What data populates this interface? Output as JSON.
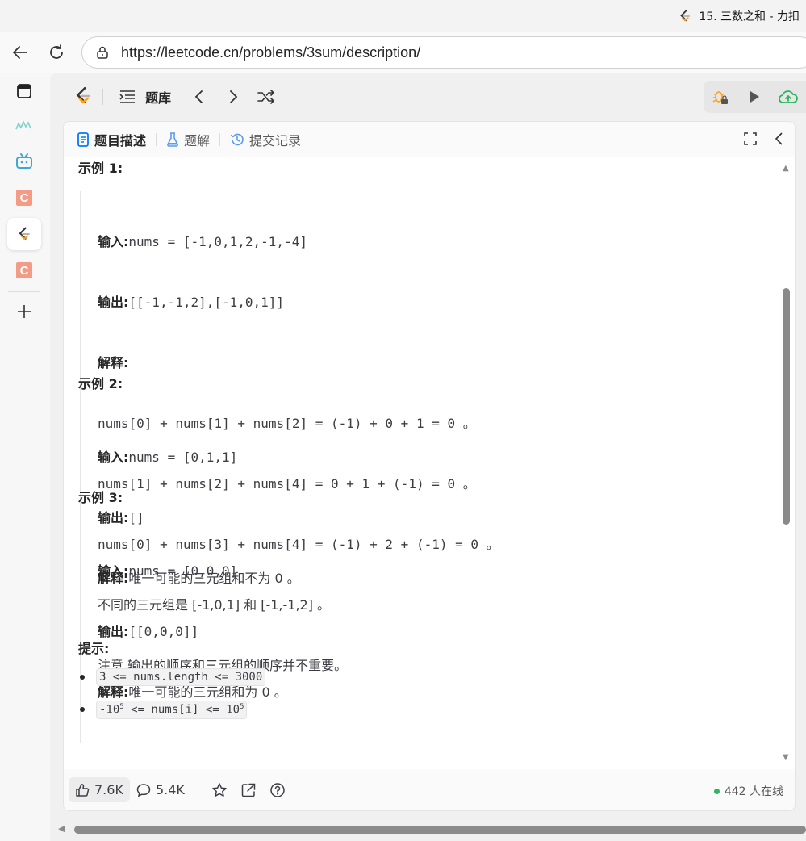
{
  "browser": {
    "tab_title": "15. 三数之和 - 力扣",
    "url": "https://leetcode.cn/problems/3sum/description/"
  },
  "header": {
    "problem_list_label": "题库"
  },
  "panel_tabs": [
    {
      "label": "题目描述"
    },
    {
      "label": "题解"
    },
    {
      "label": "提交记录"
    }
  ],
  "examples": [
    {
      "title": "示例 1:",
      "lines": [
        {
          "key": "输入:",
          "text": "nums = [-1,0,1,2,-1,-4]"
        },
        {
          "key": "输出:",
          "text": "[[-1,-1,2],[-1,0,1]]"
        },
        {
          "key": "解释:",
          "text": ""
        },
        {
          "key": "",
          "text": "nums[0] + nums[1] + nums[2] = (-1) + 0 + 1 = 0 。"
        },
        {
          "key": "",
          "text": "nums[1] + nums[2] + nums[4] = 0 + 1 + (-1) = 0 。"
        },
        {
          "key": "",
          "text": "nums[0] + nums[3] + nums[4] = (-1) + 2 + (-1) = 0 。"
        },
        {
          "key": "",
          "text": "不同的三元组是 [-1,0,1] 和 [-1,-1,2] 。"
        },
        {
          "key": "",
          "text": "注意,输出的顺序和三元组的顺序并不重要。"
        }
      ]
    },
    {
      "title": "示例 2:",
      "lines": [
        {
          "key": "输入:",
          "text": "nums = [0,1,1]"
        },
        {
          "key": "输出:",
          "text": "[]"
        },
        {
          "key": "解释:",
          "text": "唯一可能的三元组和不为 0 。"
        }
      ]
    },
    {
      "title": "示例 3:",
      "lines": [
        {
          "key": "输入:",
          "text": "nums = [0,0,0]"
        },
        {
          "key": "输出:",
          "text": "[[0,0,0]]"
        },
        {
          "key": "解释:",
          "text": "唯一可能的三元组和为 0 。"
        }
      ]
    }
  ],
  "hints": {
    "title": "提示:",
    "items": [
      {
        "text": "3 <= nums.length <= 3000"
      },
      {
        "pre": "-10",
        "sup1": "5",
        "mid": " <= nums[i] <= 10",
        "sup2": "5"
      }
    ]
  },
  "footer": {
    "likes": "7.6K",
    "comments": "5.4K",
    "online": "442 人在线"
  },
  "colors": {
    "accent_orange": "#ffa116",
    "online_green": "#2db55d",
    "upload_green": "#2db55d"
  }
}
